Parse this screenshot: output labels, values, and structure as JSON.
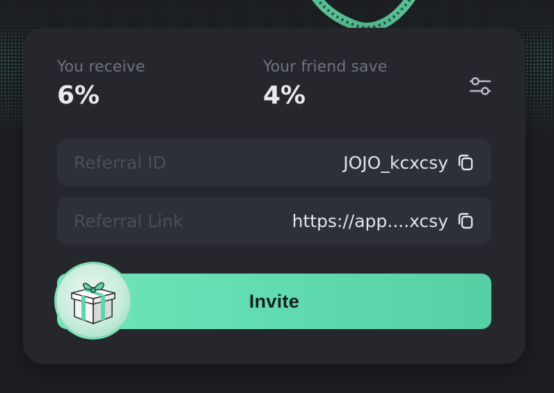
{
  "stats": [
    {
      "label": "You receive",
      "value": "6%"
    },
    {
      "label": "Your friend save",
      "value": "4%"
    }
  ],
  "fields": [
    {
      "label": "Referral ID",
      "value": "JOJO_kcxcsy",
      "icon": "copy-icon"
    },
    {
      "label": "Referral Link",
      "value": "https://app....xcsy",
      "icon": "copy-icon"
    }
  ],
  "settings": {
    "icon": "sliders-icon"
  },
  "invite": {
    "label": "Invite",
    "icon": "gift-icon"
  },
  "colors": {
    "accent": "#5fdbaf",
    "card": "#25272c",
    "field": "#2e3037",
    "background": "#1c1e22"
  }
}
